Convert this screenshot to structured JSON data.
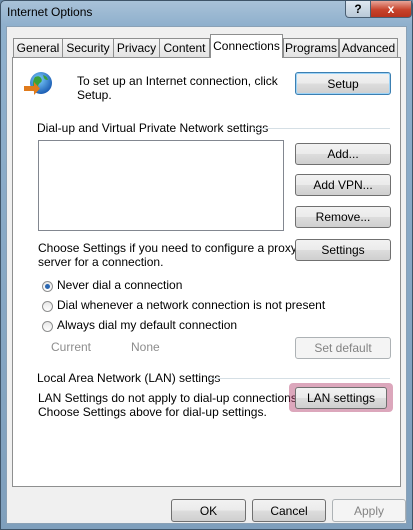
{
  "window": {
    "title": "Internet Options",
    "help_label": "?",
    "close_label": "x"
  },
  "tabs": [
    {
      "label": "General"
    },
    {
      "label": "Security"
    },
    {
      "label": "Privacy"
    },
    {
      "label": "Content"
    },
    {
      "label": "Connections",
      "active": true
    },
    {
      "label": "Programs"
    },
    {
      "label": "Advanced"
    }
  ],
  "setup": {
    "text_line1": "To set up an Internet connection, click",
    "text_line2": "Setup.",
    "button": "Setup",
    "icon": "globe-network-icon"
  },
  "dialup": {
    "group_label": "Dial-up and Virtual Private Network settings",
    "add_button": "Add...",
    "add_vpn_button": "Add VPN...",
    "remove_button": "Remove...",
    "settings_text_line1": "Choose Settings if you need to configure a proxy",
    "settings_text_line2": "server for a connection.",
    "settings_button": "Settings",
    "radio_options": [
      {
        "label": "Never dial a connection",
        "checked": true
      },
      {
        "label": "Dial whenever a network connection is not present",
        "checked": false
      },
      {
        "label": "Always dial my default connection",
        "checked": false
      }
    ],
    "current_label": "Current",
    "current_value": "None",
    "set_default_button": "Set default"
  },
  "lan": {
    "group_label": "Local Area Network (LAN) settings",
    "text_line1": "LAN Settings do not apply to dial-up connections.",
    "text_line2": "Choose Settings above for dial-up settings.",
    "button": "LAN settings"
  },
  "footer": {
    "ok": "OK",
    "cancel": "Cancel",
    "apply": "Apply"
  },
  "colors": {
    "highlight": "#b23b6a",
    "default_button_border": "#3c7fb1"
  }
}
